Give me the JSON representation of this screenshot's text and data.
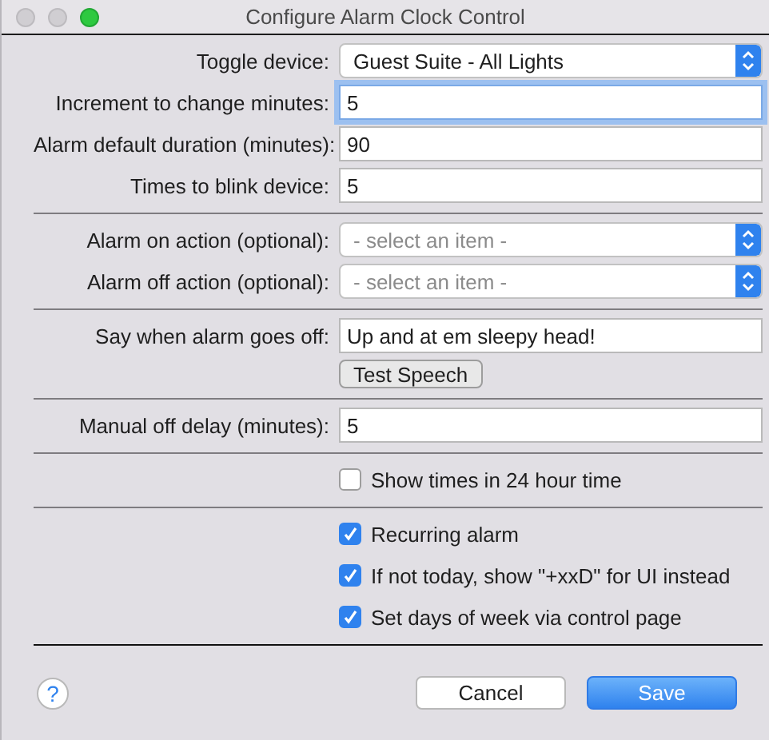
{
  "window": {
    "title": "Configure Alarm Clock Control"
  },
  "sections": [
    {
      "rows": [
        {
          "kind": "select",
          "label": "Toggle device:",
          "value": "Guest Suite - All Lights"
        },
        {
          "kind": "text",
          "label": "Increment to change minutes:",
          "value": "5",
          "focused": true
        },
        {
          "kind": "text",
          "label": "Alarm default duration (minutes):",
          "value": "90",
          "focused": false
        },
        {
          "kind": "text",
          "label": "Times to blink device:",
          "value": "5",
          "focused": false
        }
      ]
    },
    {
      "rows": [
        {
          "kind": "select",
          "label": "Alarm on action (optional):",
          "placeholder": "- select an item -"
        },
        {
          "kind": "select",
          "label": "Alarm off action (optional):",
          "placeholder": "- select an item -"
        }
      ]
    },
    {
      "rows": [
        {
          "kind": "text",
          "label": "Say when alarm goes off:",
          "value": "Up and at em sleepy head!",
          "focused": false
        },
        {
          "kind": "button",
          "label": "Test Speech"
        }
      ]
    },
    {
      "rows": [
        {
          "kind": "text",
          "label": "Manual off delay (minutes):",
          "value": "5",
          "focused": false
        }
      ]
    },
    {
      "rows": [
        {
          "kind": "checkbox",
          "label": "Show times in 24 hour time",
          "checked": false
        }
      ]
    },
    {
      "rows": [
        {
          "kind": "checkbox",
          "label": "Recurring alarm",
          "checked": true
        },
        {
          "kind": "checkbox",
          "label": "If not today, show \"+xxD\" for UI instead",
          "checked": true
        },
        {
          "kind": "checkbox",
          "label": "Set days of week via control page",
          "checked": true
        }
      ]
    }
  ],
  "footer": {
    "help": "?",
    "buttons": [
      {
        "label": "Cancel",
        "primary": false
      },
      {
        "label": "Save",
        "primary": true
      }
    ]
  }
}
